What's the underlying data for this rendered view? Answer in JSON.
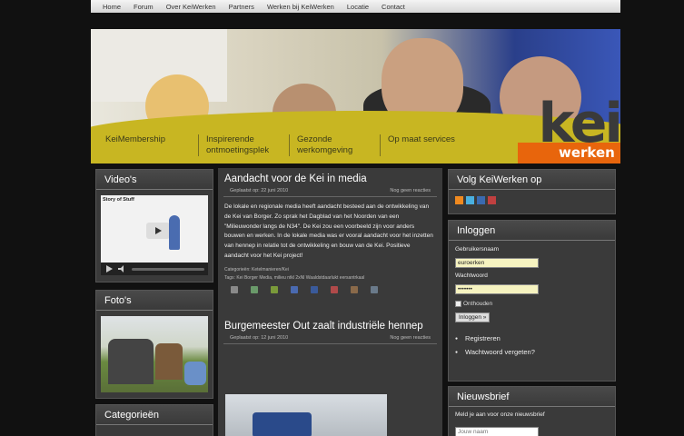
{
  "nav": [
    "Home",
    "Forum",
    "Over KeiWerken",
    "Partners",
    "Werken bij KeiWerken",
    "Locatie",
    "Contact"
  ],
  "header": {
    "logo_kei": "kei",
    "logo_werken": "werken",
    "menu": [
      "KeiMembership",
      "Inspirerende ontmoetingsplek",
      "Gezonde werkomgeving",
      "Op maat services"
    ]
  },
  "left": {
    "videos_title": "Video's",
    "video_caption": "Story of Stuff",
    "photos_title": "Foto's",
    "categories_title": "Categorieën"
  },
  "posts": [
    {
      "title": "Aandacht voor de Kei in media",
      "date": "Geplaatst op: 22 juni 2010",
      "comments": "Nog geen reacties",
      "body": "De lokale en regionale media heeft aandacht besteed aan de ontwikkeling van de Kei van Borger. Zo sprak het Dagblad van het Noorden van een \"Milieuwonder langs de N34\". De Kei zou een voorbeeld zijn voor anders bouwen en werken. In de lokale media was er vooral aandacht voor het inzetten van hennep in relatie tot de ontwikkeling en bouw van de Kei. Positieve aandacht voor het Kei project!",
      "categories": "Categorieën: Ketelmanieren/Kei",
      "tags": "Tags: Kei Borger Media, milieu ntkl 2xNl Waaldstdaarlukt eersantrkaal"
    },
    {
      "title": "Burgemeester Out zaalt industriële hennep",
      "date": "Geplaatst op: 12 juni 2010",
      "comments": "Nog geen reacties"
    }
  ],
  "right": {
    "follow_title": "Volg KeiWerken op",
    "login_title": "Inloggen",
    "username_label": "Gebruikersnaam",
    "username_value": "euroerken",
    "password_label": "Wachtwoord",
    "password_value": "•••••••",
    "remember_label": "Onthouden",
    "login_button": "Inloggen »",
    "links": [
      "Registreren",
      "Wachtwoord vergeten?"
    ],
    "newsletter_title": "Nieuwsbrief",
    "newsletter_text": "Meld je aan voor onze nieuwsbrief",
    "newsletter_placeholder": "Jouw naam"
  },
  "colors": {
    "accent_yellow": "#c8b622",
    "accent_orange": "#e8650c",
    "panel_bg": "#3a3a3a"
  }
}
